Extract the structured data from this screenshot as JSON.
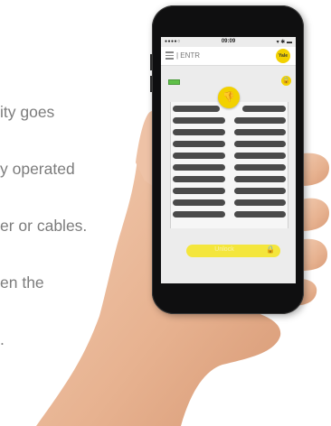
{
  "background_text": {
    "lines": [
      "ity goes",
      "y operated",
      "er or cables.",
      "en the",
      "."
    ]
  },
  "status_bar": {
    "left": "●●●●○",
    "time": "09:09",
    "right": "▾ ✱ ▬"
  },
  "app_bar": {
    "title": "| ENTR",
    "brand_logo_text": "Yale"
  },
  "lock_screen": {
    "unlock_label": "Unlock",
    "thumb_icon": "thumbs-down-icon",
    "lock_icon": "padlock-icon",
    "accent_color": "#f2d100"
  }
}
